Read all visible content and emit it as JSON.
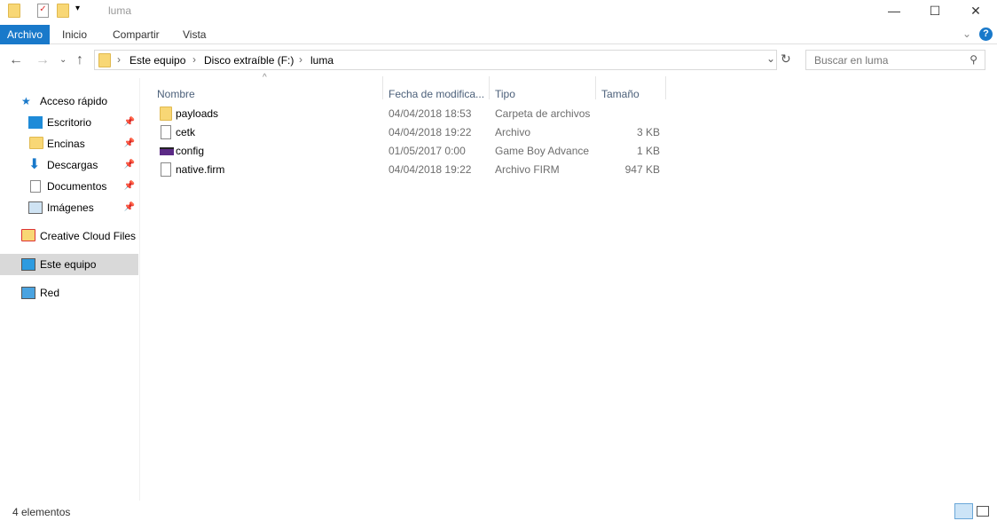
{
  "window": {
    "title": "luma",
    "minimize": "—",
    "maximize": "☐",
    "close": "✕"
  },
  "ribbon": {
    "tabs": [
      "Archivo",
      "Inicio",
      "Compartir",
      "Vista"
    ]
  },
  "address": {
    "crumbs": [
      "Este equipo",
      "Disco extraíble (F:)",
      "luma"
    ]
  },
  "search": {
    "placeholder": "Buscar en luma"
  },
  "sidebar": {
    "items": [
      {
        "label": "Acceso rápido",
        "icon": "star-icon"
      },
      {
        "label": "Escritorio",
        "icon": "desktop-icon",
        "pinned": true
      },
      {
        "label": "Encinas",
        "icon": "folder-icon",
        "pinned": true
      },
      {
        "label": "Descargas",
        "icon": "download-icon",
        "pinned": true
      },
      {
        "label": "Documentos",
        "icon": "documents-icon",
        "pinned": true
      },
      {
        "label": "Imágenes",
        "icon": "pictures-icon",
        "pinned": true
      },
      {
        "label": "Creative Cloud Files",
        "icon": "creative-cloud-icon"
      },
      {
        "label": "Este equipo",
        "icon": "computer-icon",
        "selected": true
      },
      {
        "label": "Red",
        "icon": "network-icon"
      }
    ]
  },
  "columns": [
    "Nombre",
    "Fecha de modifica...",
    "Tipo",
    "Tamaño"
  ],
  "files": [
    {
      "name": "payloads",
      "date": "04/04/2018 18:53",
      "type": "Carpeta de archivos",
      "size": "",
      "icon": "folder-icon"
    },
    {
      "name": "cetk",
      "date": "04/04/2018 19:22",
      "type": "Archivo",
      "size": "3 KB",
      "icon": "file-icon"
    },
    {
      "name": "config",
      "date": "01/05/2017 0:00",
      "type": "Game Boy Advance",
      "size": "1 KB",
      "icon": "gba-icon"
    },
    {
      "name": "native.firm",
      "date": "04/04/2018 19:22",
      "type": "Archivo FIRM",
      "size": "947 KB",
      "icon": "file-icon"
    }
  ],
  "status": {
    "count": "4 elementos"
  }
}
